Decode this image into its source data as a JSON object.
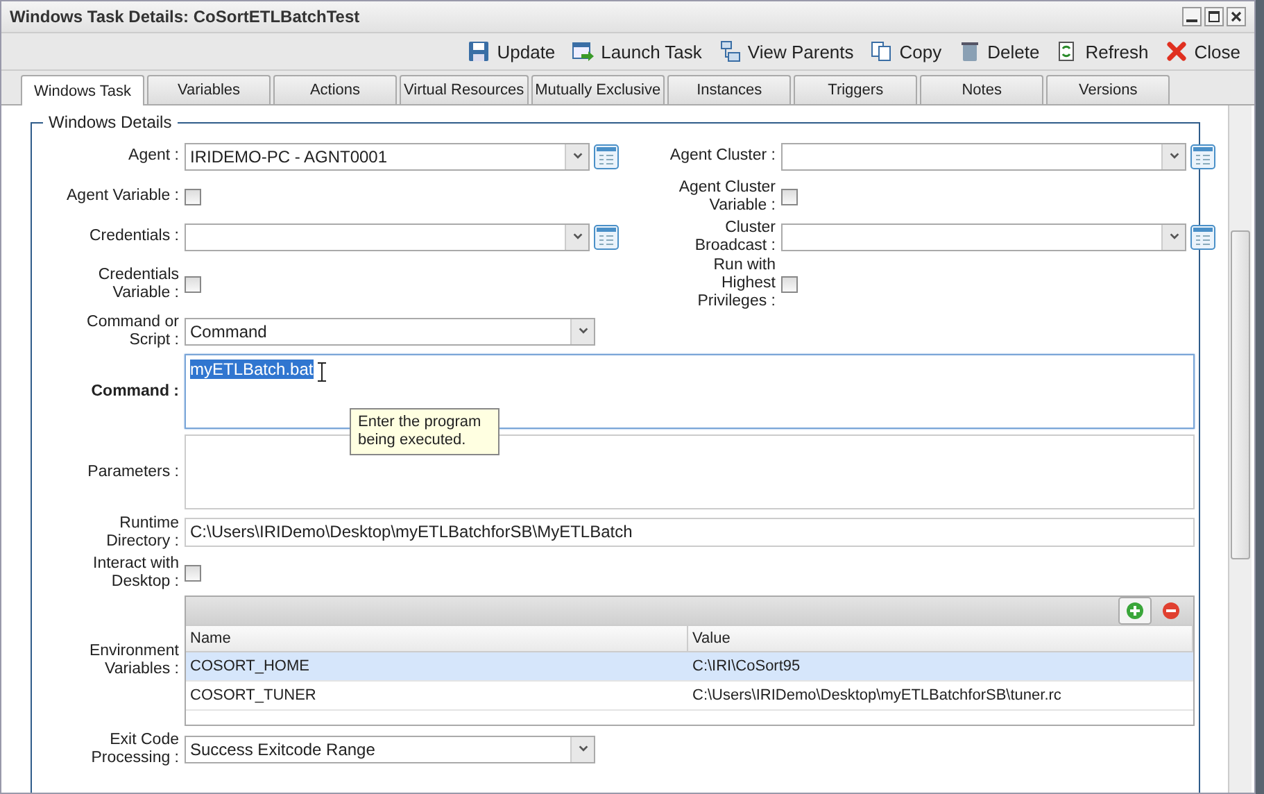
{
  "window": {
    "title": "Windows Task Details: CoSortETLBatchTest"
  },
  "toolbar": [
    {
      "kind": "update",
      "label": "Update"
    },
    {
      "kind": "launch",
      "label": "Launch Task"
    },
    {
      "kind": "parents",
      "label": "View Parents"
    },
    {
      "kind": "copy",
      "label": "Copy"
    },
    {
      "kind": "delete",
      "label": "Delete"
    },
    {
      "kind": "refresh",
      "label": "Refresh"
    },
    {
      "kind": "close",
      "label": "Close"
    }
  ],
  "tabs": [
    {
      "label": "Windows Task",
      "selected": true
    },
    {
      "label": "Variables",
      "selected": false
    },
    {
      "label": "Actions",
      "selected": false
    },
    {
      "label": "Virtual Resources",
      "selected": false
    },
    {
      "label": "Mutually Exclusive",
      "selected": false
    },
    {
      "label": "Instances",
      "selected": false
    },
    {
      "label": "Triggers",
      "selected": false
    },
    {
      "label": "Notes",
      "selected": false
    },
    {
      "label": "Versions",
      "selected": false
    }
  ],
  "section": {
    "title": "Windows Details",
    "paired_rows": [
      [
        {
          "kind": "lookup",
          "label": "Agent :",
          "value": "IRIDEMO-PC - AGNT0001"
        },
        {
          "kind": "lookup",
          "label": "Agent Cluster :"
        }
      ],
      [
        {
          "kind": "checkbox",
          "label": "Agent Variable :",
          "checked": false
        },
        {
          "kind": "checkbox",
          "label": "Agent Cluster Variable :",
          "checked": false
        }
      ],
      [
        {
          "kind": "lookup",
          "label": "Credentials :"
        },
        {
          "kind": "lookup",
          "label": "Cluster Broadcast :"
        }
      ],
      [
        {
          "kind": "checkbox",
          "label": "Credentials Variable :",
          "checked": false
        },
        {
          "kind": "checkbox",
          "label": "Run with Highest Privileges :",
          "checked": false
        }
      ]
    ],
    "fields": [
      {
        "kind": "select",
        "label": "Command or Script :",
        "value": "Command"
      },
      {
        "kind": "textarea",
        "label": "Command :",
        "value": "myETLBatch.bat",
        "focused": true,
        "tooltip": "Enter the program being executed."
      },
      {
        "kind": "textarea",
        "label": "Parameters :",
        "focused": false
      },
      {
        "kind": "text",
        "label": "Runtime Directory :",
        "value": "C:\\Users\\IRIDemo\\Desktop\\myETLBatchforSB\\MyETLBatch"
      },
      {
        "kind": "checkbox",
        "label": "Interact with Desktop :",
        "checked": false
      },
      {
        "kind": "table",
        "label": "Environment Variables :",
        "columns": [
          "Name",
          "Value"
        ],
        "rows": [
          {
            "cells": [
              "COSORT_HOME",
              "C:\\IRI\\CoSort95"
            ],
            "selected": true
          },
          {
            "cells": [
              "COSORT_TUNER",
              "C:\\Users\\IRIDemo\\Desktop\\myETLBatchforSB\\tuner.rc"
            ],
            "selected": false
          }
        ]
      },
      {
        "kind": "select",
        "label": "Exit Code Processing :",
        "value": "Success Exitcode Range"
      }
    ]
  }
}
